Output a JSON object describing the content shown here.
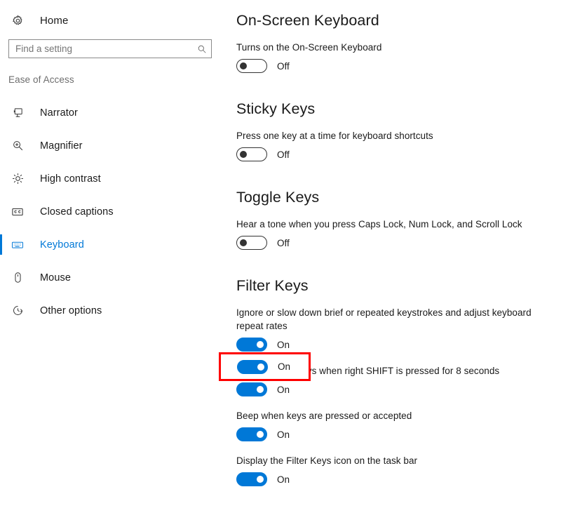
{
  "theme": {
    "accent": "#0078d7",
    "highlight": "#fe0000",
    "text": "#1a1a1a",
    "muted": "#6e6e6e"
  },
  "sidebar": {
    "home": {
      "label": "Home",
      "icon": "gear-icon"
    },
    "search": {
      "value": "",
      "placeholder": "Find a setting",
      "icon": "search-icon"
    },
    "category_label": "Ease of Access",
    "items": [
      {
        "label": "Narrator",
        "icon": "narrator-icon",
        "selected": false
      },
      {
        "label": "Magnifier",
        "icon": "magnifier-icon",
        "selected": false
      },
      {
        "label": "High contrast",
        "icon": "high-contrast-icon",
        "selected": false
      },
      {
        "label": "Closed captions",
        "icon": "closed-captions-icon",
        "selected": false
      },
      {
        "label": "Keyboard",
        "icon": "keyboard-icon",
        "selected": true
      },
      {
        "label": "Mouse",
        "icon": "mouse-icon",
        "selected": false
      },
      {
        "label": "Other options",
        "icon": "other-options-icon",
        "selected": false
      }
    ]
  },
  "main": {
    "groups": [
      {
        "title": "On-Screen Keyboard",
        "settings": [
          {
            "desc": "Turns on the On-Screen Keyboard",
            "state": "Off",
            "on": false
          }
        ]
      },
      {
        "title": "Sticky Keys",
        "settings": [
          {
            "desc": "Press one key at a time for keyboard shortcuts",
            "state": "Off",
            "on": false
          }
        ]
      },
      {
        "title": "Toggle Keys",
        "settings": [
          {
            "desc": "Hear a tone when you press Caps Lock, Num Lock, and Scroll Lock",
            "state": "Off",
            "on": false
          }
        ]
      },
      {
        "title": "Filter Keys",
        "settings": [
          {
            "desc": "Ignore or slow down brief or repeated keystrokes and adjust keyboard repeat rates",
            "state": "On",
            "on": true
          },
          {
            "desc": "Turn on Filter Keys when right SHIFT is pressed for 8 seconds",
            "state": "On",
            "on": true
          },
          {
            "desc": "Beep when keys are pressed or accepted",
            "state": "On",
            "on": true
          },
          {
            "desc": "Display the Filter Keys icon on the task bar",
            "state": "On",
            "on": true
          }
        ]
      }
    ]
  },
  "annotation": {
    "target_state": "On",
    "color": "#fe0000"
  }
}
